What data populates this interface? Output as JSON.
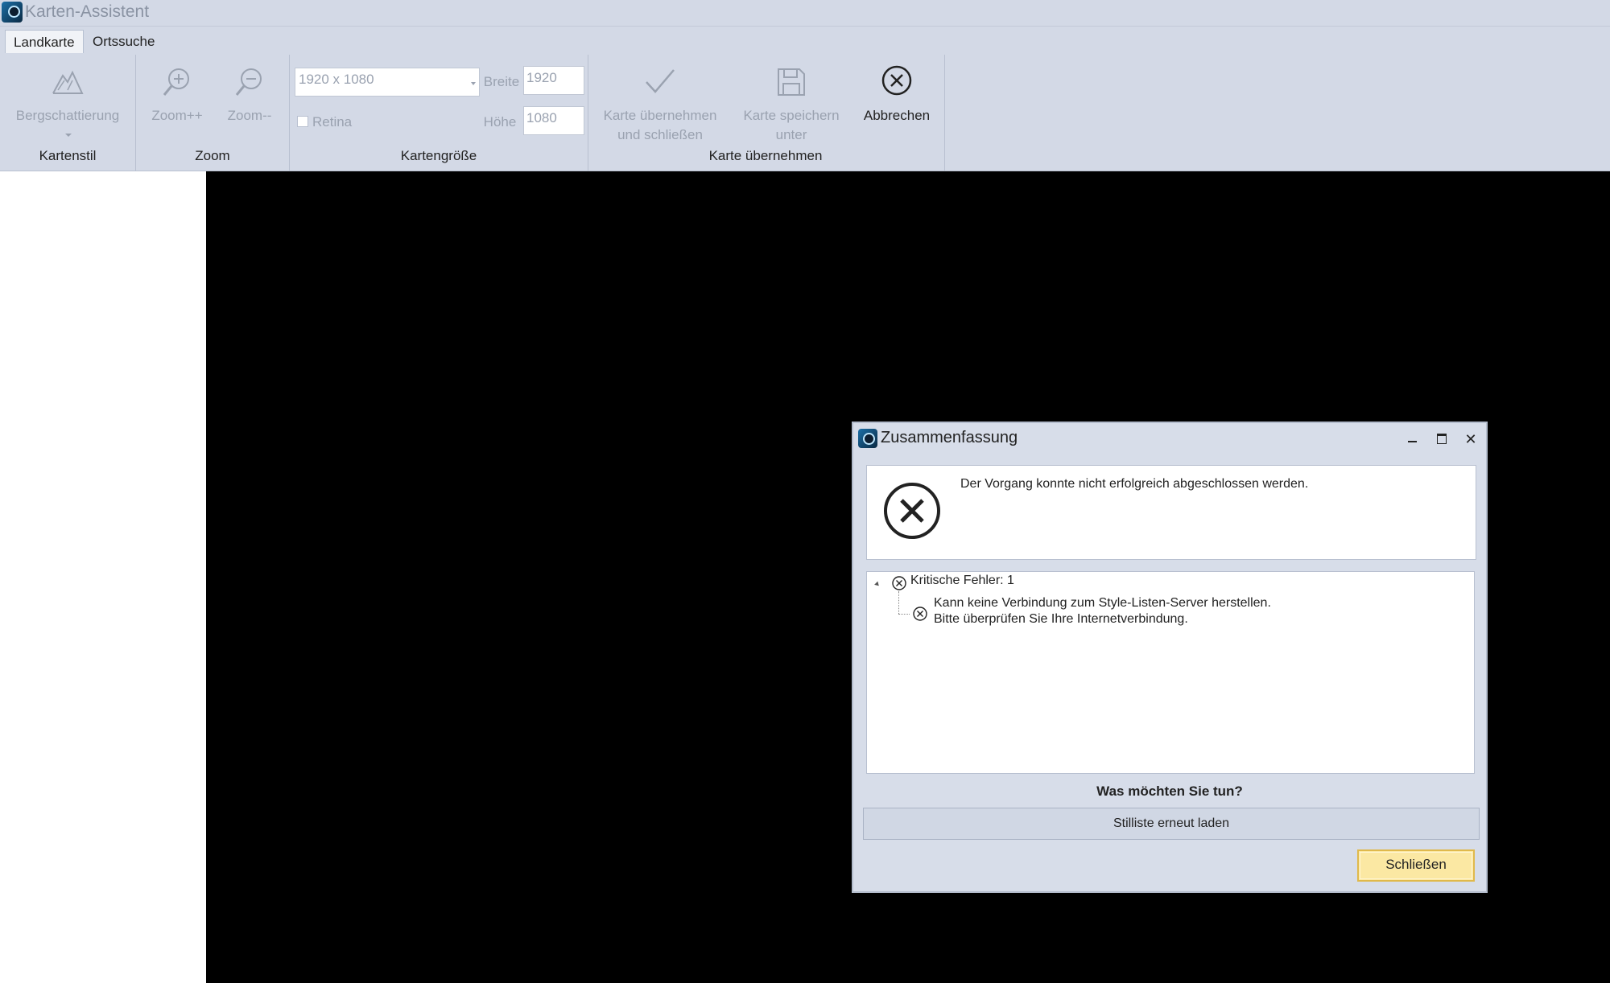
{
  "app": {
    "title": "Karten-Assistent"
  },
  "tabs": [
    {
      "label": "Landkarte"
    },
    {
      "label": "Ortssuche"
    }
  ],
  "ribbon": {
    "kartenstil": {
      "hillshade_label": "Bergschattierung",
      "group_label": "Kartenstil"
    },
    "zoom": {
      "zoom_in_label": "Zoom++",
      "zoom_out_label": "Zoom--",
      "group_label": "Zoom"
    },
    "kartengroesse": {
      "size_value": "1920 x 1080",
      "width_label": "Breite",
      "width_value": "1920",
      "height_label": "Höhe",
      "height_value": "1080",
      "retina_label": "Retina",
      "group_label": "Kartengröße"
    },
    "uebernehmen": {
      "apply_close_line1": "Karte übernehmen",
      "apply_close_line2": "und schließen",
      "save_as_line1": "Karte speichern",
      "save_as_line2": "unter",
      "cancel_label": "Abbrechen",
      "group_label": "Karte übernehmen"
    }
  },
  "dialog": {
    "title": "Zusammenfassung",
    "message": "Der Vorgang konnte nicht erfolgreich abgeschlossen werden.",
    "tree": {
      "root_label": "Kritische Fehler: 1",
      "child_line1": "Kann keine Verbindung zum Style-Listen-Server herstellen.",
      "child_line2": "Bitte überprüfen Sie Ihre Internetverbindung."
    },
    "question": "Was möchten Sie tun?",
    "reload_button": "Stilliste erneut laden",
    "close_button": "Schließen"
  }
}
